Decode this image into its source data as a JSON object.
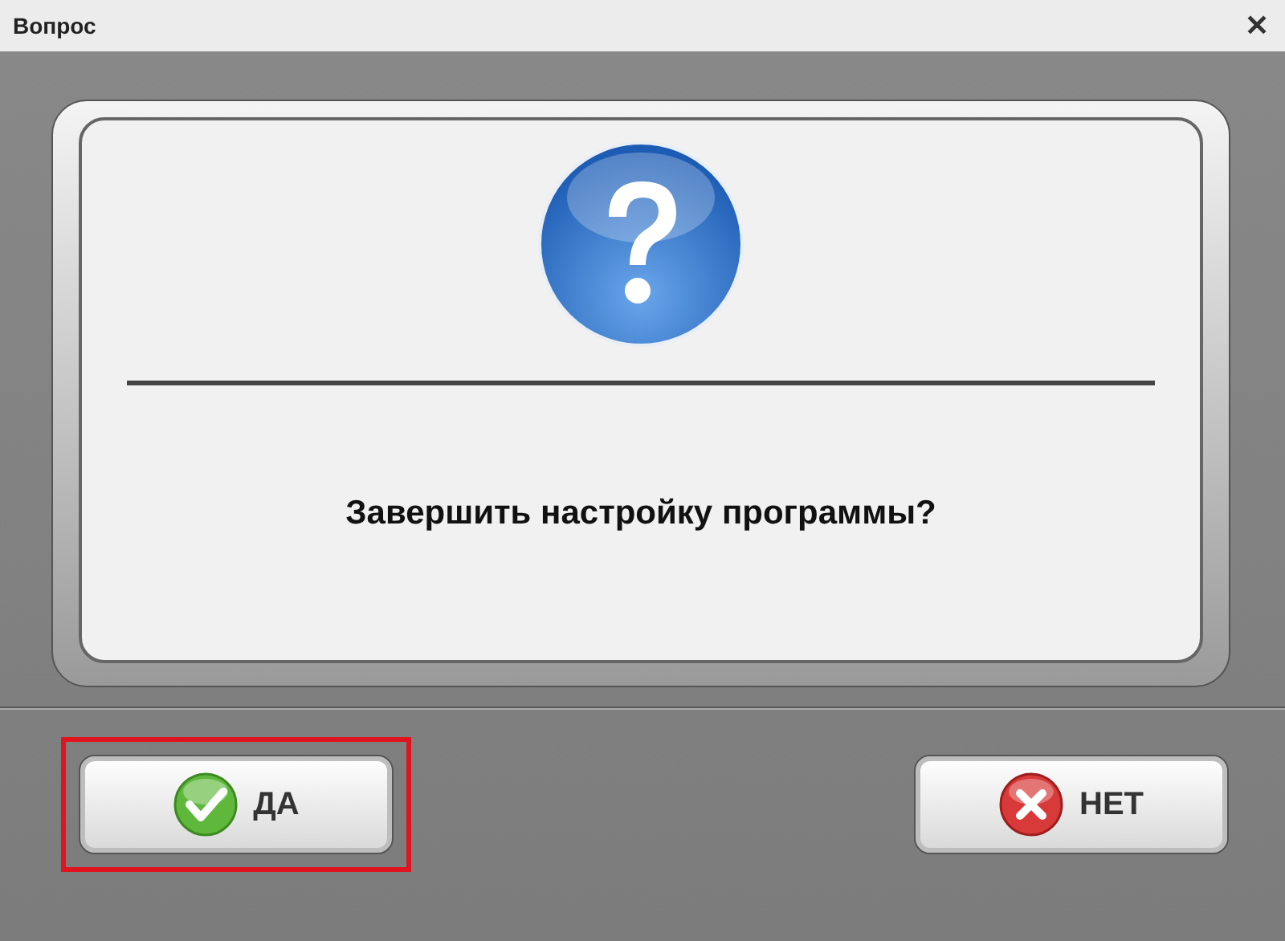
{
  "window": {
    "title": "Вопрос",
    "close": "✕"
  },
  "message": "Завершить настройку программы?",
  "buttons": [
    {
      "label": "ДА",
      "kind": "yes",
      "highlighted": true
    },
    {
      "label": "НЕТ",
      "kind": "no",
      "highlighted": false
    }
  ]
}
